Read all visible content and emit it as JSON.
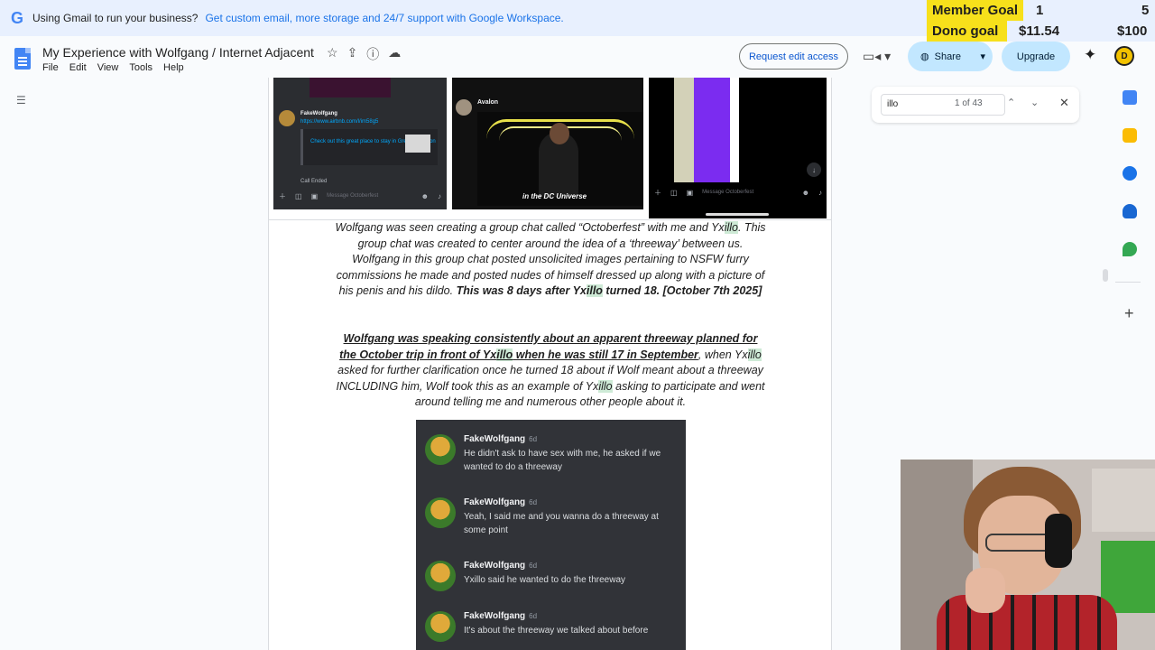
{
  "promo": {
    "lead": "Using Gmail to run your business?",
    "link": "Get custom email, more storage and 24/7 support with Google Workspace."
  },
  "overlay": {
    "member_label": "Member Goal",
    "member_current": "1",
    "member_target": "5",
    "dono_label": "Dono goal",
    "dono_current": "$11.54",
    "dono_target": "$100"
  },
  "doc": {
    "title": "My Experience with Wolfgang / Internet Adjacent",
    "menu": [
      "File",
      "Edit",
      "View",
      "Tools",
      "Help"
    ],
    "request_edit": "Request edit access",
    "share": "Share",
    "upgrade": "Upgrade",
    "avatar_letter": "D"
  },
  "find": {
    "query": "illo",
    "count": "1 of 43"
  },
  "screenshots": {
    "a_user": "FakeWolfgang",
    "a_link": "https://www.airbnb.com/l/im58g5",
    "a_card": "Check out this great place to stay in Greater London",
    "a_call": "Call Ended",
    "a_placeholder": "Message Octoberfest",
    "b_user": "Avalon",
    "b_caption": "in the DC Universe",
    "c_placeholder": "Message Octoberfest"
  },
  "paragraph1": {
    "s1": "Wolfgang was seen creating a group chat called “Octoberfest” with me and Yx",
    "h1": "illo",
    "s2": ". This group chat was created to center around the idea of a ‘threeway’ between us. Wolfgang in this group chat posted unsolicited images pertaining to NSFW furry commissions he made and posted nudes of himself dressed up along with a picture of his penis and his dildo. ",
    "b1": "This was 8 days after Yx",
    "h2": "illo",
    "b2": " turned 18. [October 7th 2025]"
  },
  "paragraph2": {
    "u1": "Wolfgang was speaking consistently about an apparent threeway planned for the October trip in front of Yx",
    "h1": "illo",
    "u2": " when he was still 17 in September",
    "s1": ", when Yx",
    "h2": "illo",
    "s2": " asked for further clarification once he turned 18 about if Wolf meant about a threeway INCLUDING him, Wolf took this as an example of Yx",
    "h3": "illo",
    "s3": " asking to participate and went around telling me and numerous other people about it."
  },
  "chat": [
    {
      "name": "FakeWolfgang",
      "time": "6d",
      "text": "He didn't ask to have sex with me, he asked if we wanted to do a threeway"
    },
    {
      "name": "FakeWolfgang",
      "time": "6d",
      "text": "Yeah, I said me and you wanna do a threeway at some point"
    },
    {
      "name": "FakeWolfgang",
      "time": "6d",
      "text": "Yxillo said he wanted to do the threeway"
    },
    {
      "name": "FakeWolfgang",
      "time": "6d",
      "text": "It's about the threeway we talked about before"
    }
  ],
  "colors": {
    "share_bg": "#c2e7ff",
    "highlight": "#ceead6",
    "goal_label_bg": "#f7e01b",
    "link": "#1a73e8"
  }
}
